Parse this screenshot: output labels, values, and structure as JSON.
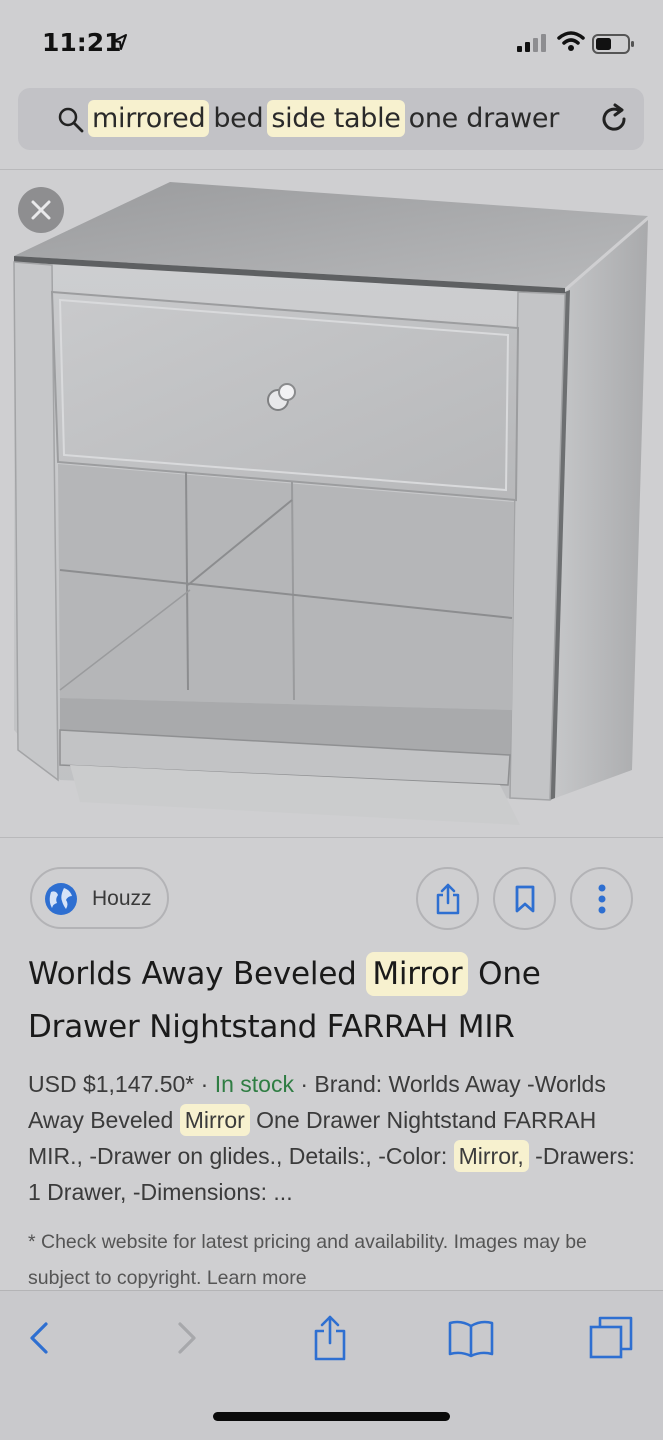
{
  "status_bar": {
    "time": "11:21",
    "icons": [
      "location-arrow-icon",
      "cellular-signal-icon",
      "wifi-icon",
      "battery-icon"
    ]
  },
  "search": {
    "query_words": [
      {
        "text": "mirrored",
        "highlighted": true
      },
      {
        "text": "bed",
        "highlighted": false
      },
      {
        "text": "side table",
        "highlighted": true
      },
      {
        "text": "one drawer",
        "highlighted": false
      }
    ]
  },
  "image": {
    "alt": "Mirrored nightstand with one drawer"
  },
  "result": {
    "source_name": "Houzz",
    "title_parts": {
      "before": "Worlds Away Beveled ",
      "highlight": "Mirror",
      "after": " One Drawer Nightstand FARRAH MIR"
    },
    "price": "USD $1,147.50*",
    "separator": "·",
    "availability": "In stock",
    "brand": "Brand: Worlds Away",
    "description": {
      "part1": "-Worlds Away Beveled ",
      "highlight1": "Mirror",
      "part2": " One Drawer Nightstand FARRAH MIR., -Drawer on glides., Details:, -Color: ",
      "highlight2": "Mirror,",
      "part3": " -Drawers: 1 Drawer, -Dimensions: ..."
    },
    "disclaimer": "* Check website for latest pricing and availability. Images may be subject to copyright. Learn more"
  },
  "colors": {
    "highlight": "#f7f1cf",
    "accent_blue": "#2e6fd1",
    "stock_green": "#2f7d43"
  }
}
